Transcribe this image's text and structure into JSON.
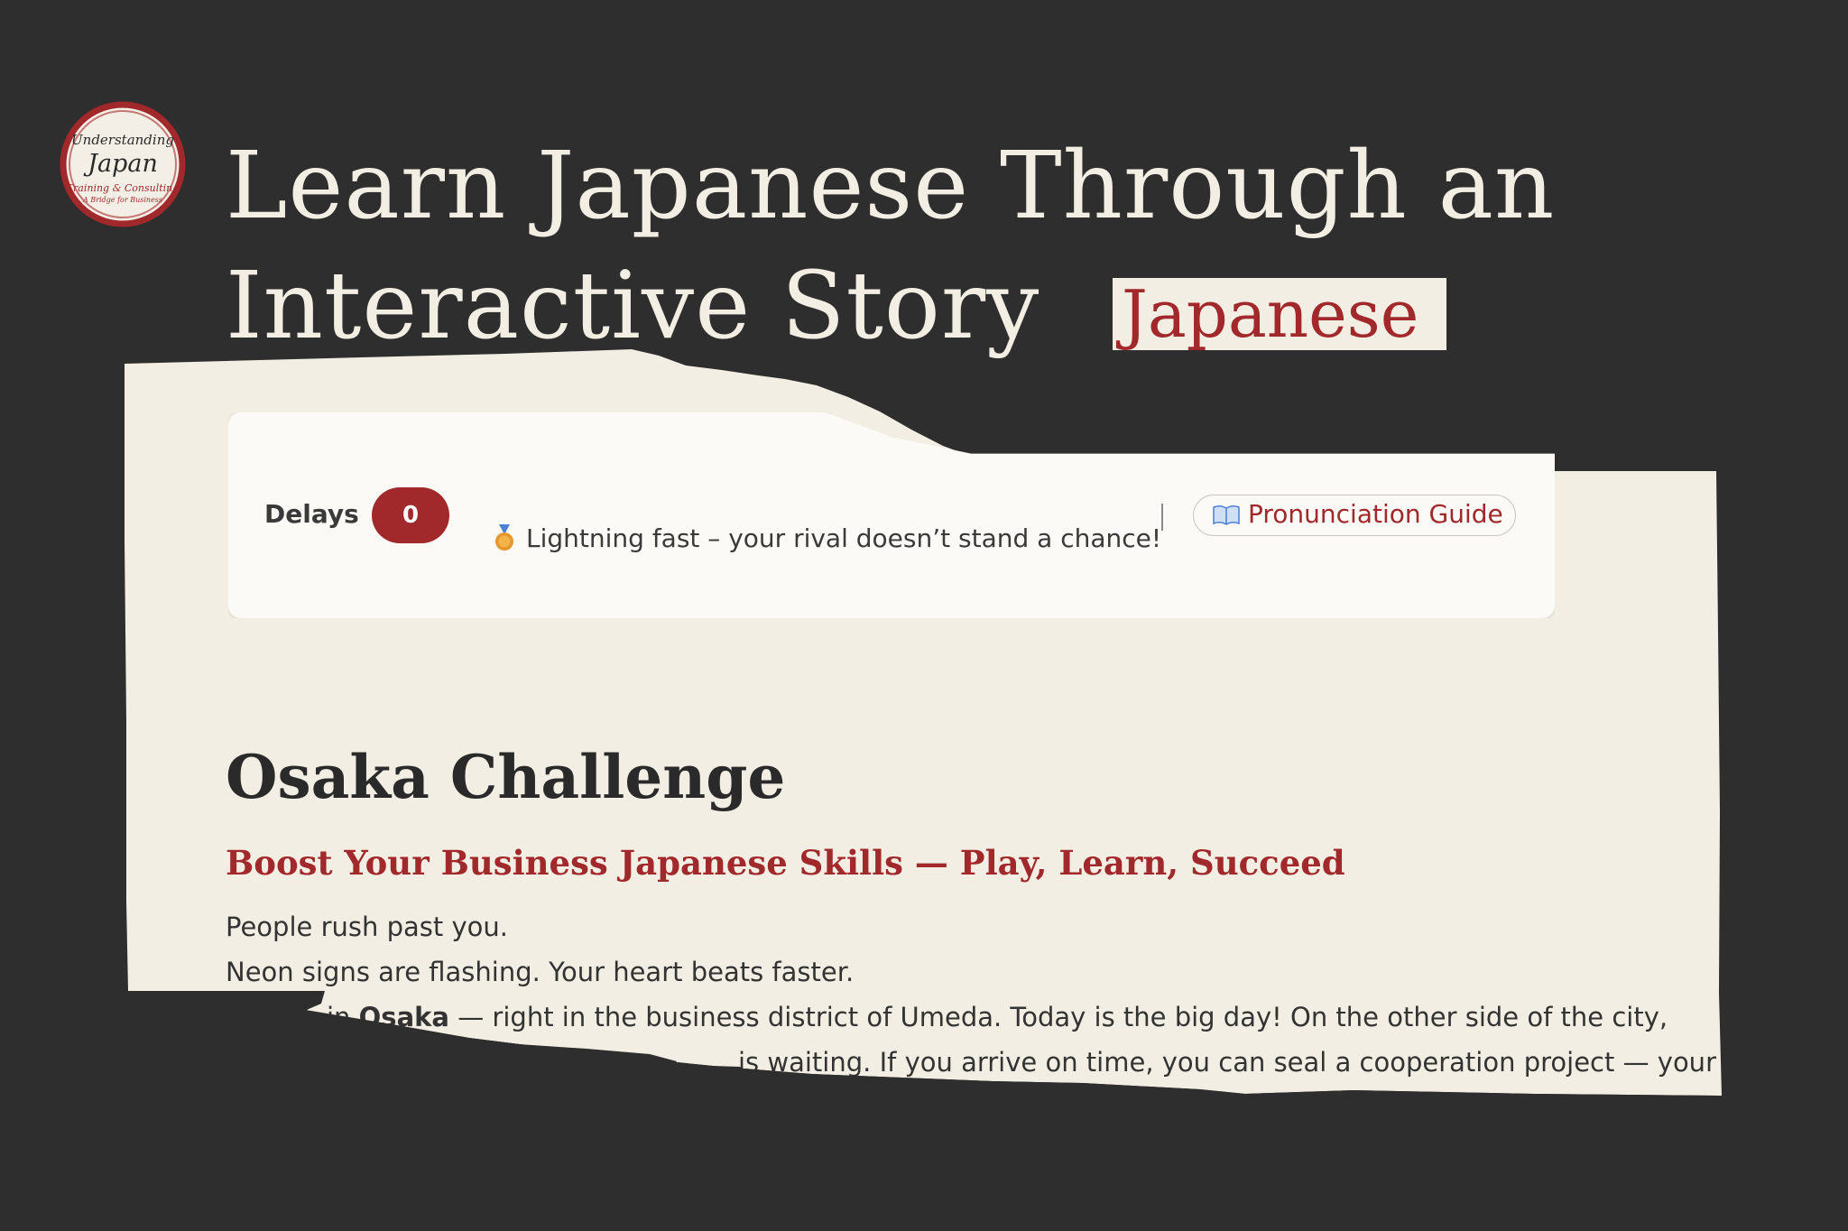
{
  "logo": {
    "line1": "Understanding",
    "line2": "Japan",
    "line3": "Training & Consulting",
    "line4": "A Bridge for Business"
  },
  "headline": {
    "line1": "Learn Japanese Through an",
    "line2": "Interactive Story"
  },
  "language_tag": "Japanese",
  "status_bar": {
    "delays_label": "Delays",
    "delays_count": "0",
    "message": "Lightning fast – your rival doesn’t stand a chance!",
    "medal_icon": "medal-icon",
    "divider": "|",
    "pronunciation_button": "Pronunciation Guide",
    "book_icon": "open-book-icon"
  },
  "story": {
    "title": "Osaka Challenge",
    "subtitle": "Boost Your Business Japanese Skills — Play, Learn, Succeed",
    "line1": "People rush past you.",
    "line2": "Neon signs are flashing. Your heart beats faster.",
    "line3_pre": "in ",
    "line3_bold": "Osaka",
    "line3_post": " — right in the business district of Umeda. Today is the big day! On the other side of the city,",
    "line4": "is waiting. If you arrive on time, you can seal a cooperation project — your"
  },
  "colors": {
    "background": "#2e2e2e",
    "paper": "#f3eee3",
    "accent": "#a1282b",
    "text": "#333333"
  }
}
